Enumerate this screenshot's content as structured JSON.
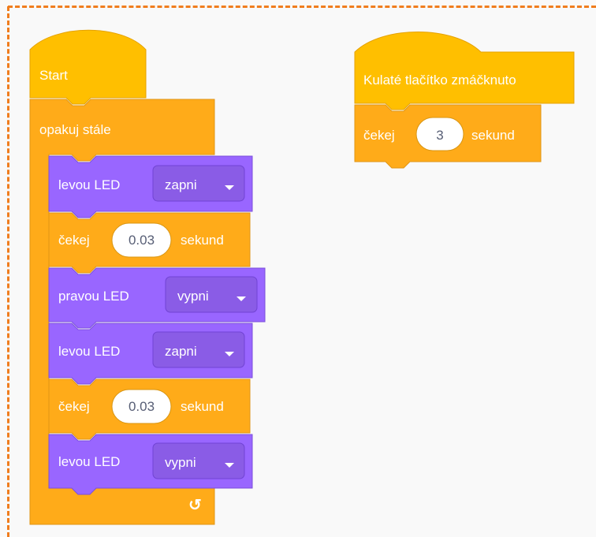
{
  "script1": {
    "hat_label": "Start",
    "forever_label": "opakuj stále",
    "loop_icon": "↺",
    "blocks": [
      {
        "label": "levou LED",
        "dropdown": "zapni"
      },
      {
        "label": "čekej",
        "value": "0.03",
        "unit": "sekund"
      },
      {
        "label": "pravou LED",
        "dropdown": "vypni"
      },
      {
        "label": "levou LED",
        "dropdown": "zapni"
      },
      {
        "label": "čekej",
        "value": "0.03",
        "unit": "sekund"
      },
      {
        "label": "levou LED",
        "dropdown": "vypni"
      }
    ]
  },
  "script2": {
    "hat_label": "Kulaté tlačítko zmáčknuto",
    "wait": {
      "label": "čekej",
      "value": "3",
      "unit": "sekund"
    }
  },
  "colors": {
    "events": "#ffbf00",
    "control": "#ffab19",
    "looks": "#9966ff",
    "border": "#f07d1e"
  }
}
